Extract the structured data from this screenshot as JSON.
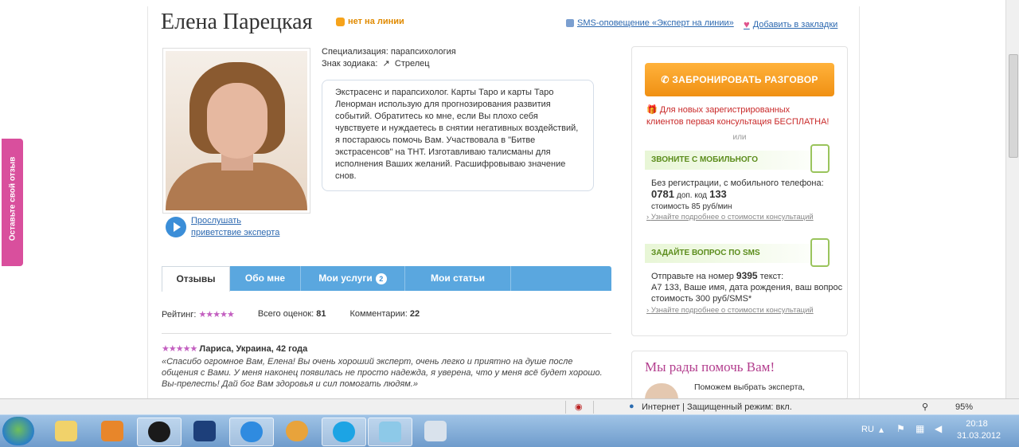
{
  "expert": {
    "name": "Елена Парецкая",
    "status": "нет на линии",
    "specialization": "Специализация: парапсихология",
    "zodiac": "Знак зодиака:",
    "zodiac_value": "Стрелец",
    "listen_line1": "Прослушать",
    "listen_line2": "приветствие эксперта",
    "about": "Экстрасенс и парапсихолог. Карты Таро и карты Таро Ленорман использую для прогнозирования развития событий. Обратитесь ко мне, если Вы плохо себя чувствуете и нуждаетесь в снятии негативных воздействий, я постараюсь помочь Вам. Участвовала в \"Битве экстрасенсов\" на ТНТ. Изготавливаю талисманы для исполнения Ваших желаний. Расшифровываю значение снов."
  },
  "header_links": {
    "sms": "SMS-оповещение «Эксперт на линии»",
    "bookmark": "Добавить в закладки"
  },
  "tabs": [
    {
      "label": "Отзывы"
    },
    {
      "label": "Обо мне"
    },
    {
      "label": "Мои услуги",
      "badge": "2"
    },
    {
      "label": "Мои статьи"
    }
  ],
  "rating": {
    "label": "Рейтинг:",
    "stars": "★★★★★",
    "total_label": "Всего оценок:",
    "total": "81",
    "comments_label": "Комментарии:",
    "comments": "22"
  },
  "review": {
    "stars": "★★★★★",
    "author": "Лариса, Украина, 42 года",
    "text": "«Спасибо огромное Вам, Елена! Вы очень хороший эксперт, очень легко и приятно на душе после общения с Вами. У меня наконец появилась не просто надежда, я уверена, что у меня всё будет хорошо. Вы-прелесть! Дай бог Вам здоровья и сил помогать людям.»"
  },
  "sidebar": {
    "book_button": "ЗАБРОНИРОВАТЬ РАЗГОВОР",
    "promo_line1": "Для новых зарегистрированных",
    "promo_line2": "клиентов первая консультация БЕСПЛАТНА!",
    "or": "или",
    "mobile_head": "ЗВОНИТЕ С МОБИЛЬНОГО",
    "mobile_line1": "Без регистрации, с мобильного телефона:",
    "mobile_number": "0781",
    "mobile_code_label": "доп. код",
    "mobile_code": "133",
    "mobile_price": "стоимость 85 руб/мин",
    "mobile_link": "Узнайте подробнее о стоимости консультаций",
    "sms_head": "ЗАДАЙТЕ ВОПРОС ПО SMS",
    "sms_line1_prefix": "Отправьте на номер",
    "sms_number": "9395",
    "sms_line1_suffix": "текст:",
    "sms_line2": "А7 133, Ваше имя, дата рождения, ваш вопрос",
    "sms_price": "стоимость 300 руб/SMS*",
    "sms_link": "Узнайте подробнее о стоимости консультаций",
    "help_title": "Мы рады помочь Вам!",
    "help_text": "Поможем выбрать эксперта,"
  },
  "feedback_tab": "Оставьте свой отзыв",
  "browser_status": {
    "zone": "Интернет | Защищенный режим: вкл.",
    "zoom": "95%"
  },
  "taskbar": {
    "lang": "RU",
    "time": "20:18",
    "date": "31.03.2012"
  },
  "colors": {
    "accent_blue": "#5aa7df",
    "book_orange": "#f09013",
    "promo_red": "#c92a2a",
    "star_pink": "#c35fc0"
  }
}
